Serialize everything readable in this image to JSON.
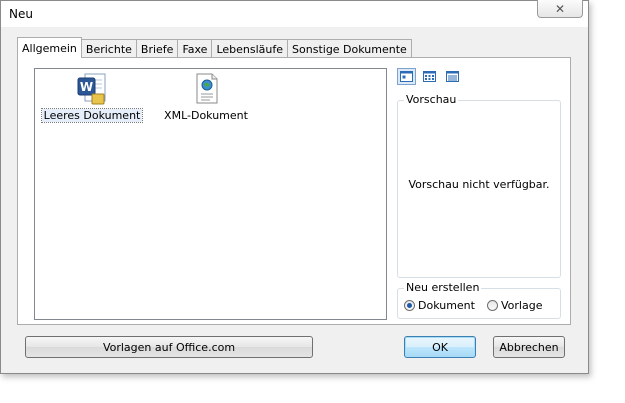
{
  "dialog": {
    "title": "Neu",
    "close_glyph": "✕"
  },
  "tabs": [
    {
      "label": "Allgemein",
      "active": true
    },
    {
      "label": "Berichte"
    },
    {
      "label": "Briefe"
    },
    {
      "label": "Faxe"
    },
    {
      "label": "Lebensläufe"
    },
    {
      "label": "Sonstige Dokumente"
    }
  ],
  "templates": [
    {
      "label": "Leeres Dokument",
      "icon": "word-document-icon",
      "selected": true
    },
    {
      "label": "XML-Dokument",
      "icon": "xml-document-icon",
      "selected": false
    }
  ],
  "view_buttons": [
    {
      "icon": "large-icons-view-icon",
      "active": true
    },
    {
      "icon": "list-view-icon"
    },
    {
      "icon": "details-view-icon"
    }
  ],
  "preview": {
    "legend": "Vorschau",
    "text": "Vorschau nicht verfügbar."
  },
  "create_new": {
    "legend": "Neu erstellen",
    "options": [
      {
        "label": "Dokument",
        "checked": true
      },
      {
        "label": "Vorlage",
        "checked": false
      }
    ]
  },
  "buttons": {
    "office_templates": "Vorlagen auf Office.com",
    "ok": "OK",
    "cancel": "Abbrechen"
  },
  "colors": {
    "accent": "#3c7fb1",
    "dialog_bg": "#f0f0f0",
    "word_blue": "#2b5797"
  }
}
